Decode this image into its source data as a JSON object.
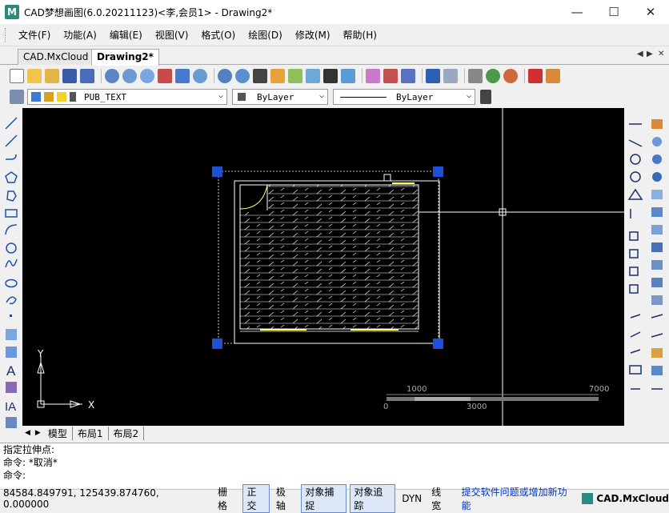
{
  "window": {
    "title": "CAD梦想画图(6.0.20211123)<李,会员1> - Drawing2*",
    "logo_text": "M",
    "minimize": "—",
    "maximize": "☐",
    "close": "✕"
  },
  "menu": [
    "文件(F)",
    "功能(A)",
    "编辑(E)",
    "视图(V)",
    "格式(O)",
    "绘图(D)",
    "修改(M)",
    "帮助(H)"
  ],
  "doc_tabs": [
    "CAD.MxCloud",
    "Drawing2*"
  ],
  "tab_nav": {
    "prev": "◀",
    "next": "▶",
    "close": "✕"
  },
  "layer_combo": "PUB_TEXT",
  "color_combo": "ByLayer",
  "linetype_combo": "ByLayer",
  "canvas": {
    "ucs_y": "Y",
    "ucs_x": "X",
    "scale_top_left": "1000",
    "scale_top_right": "7000",
    "scale_bottom_left": "0",
    "scale_bottom_mid": "3000"
  },
  "layout_tabs": [
    "模型",
    "布局1",
    "布局2"
  ],
  "command": {
    "line1": "指定拉伸点:",
    "line2": "命令:  *取消*",
    "line3": "命令:"
  },
  "status": {
    "coords": "84584.849791,  125439.874760,  0.000000",
    "items": [
      "栅格",
      "正交",
      "极轴",
      "对象捕捉",
      "对象追踪",
      "DYN",
      "线宽"
    ],
    "active": [
      "正交",
      "对象捕捉",
      "对象追踪"
    ],
    "feedback_link": "提交软件问题或增加新功能",
    "brand": "CAD.MxCloud"
  },
  "colors": {
    "canvas_bg": "#000000",
    "grip_blue": "#1e4fd8",
    "drawing_line": "#ffffff",
    "highlight_yellow": "#ffff66"
  }
}
